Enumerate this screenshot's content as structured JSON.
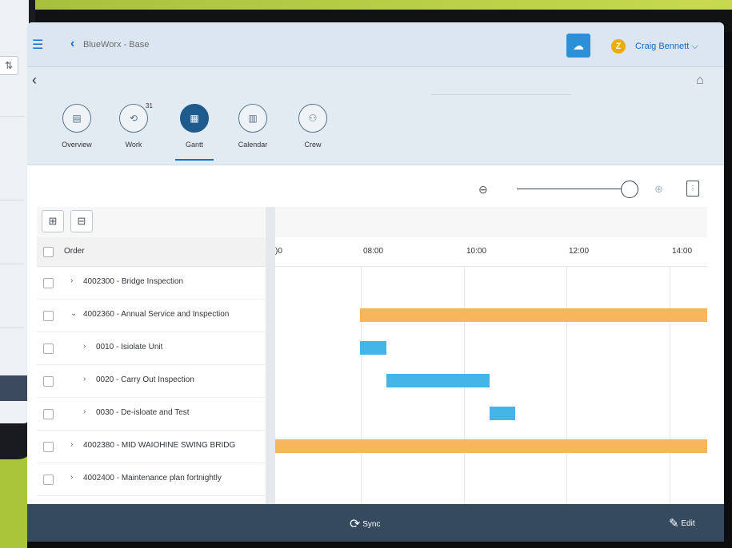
{
  "background": {
    "accent_green": "#a9c63b",
    "frame_dark": "#0d0d0f"
  },
  "left_panel": {
    "sort_icon_glyph": "⇅"
  },
  "shell": {
    "menu_icon": "☰",
    "back_icon": "‹",
    "app_title": "BlueWorx - Base",
    "notification_icon": "☁",
    "logo_letter": "Z",
    "user_name": "Craig Bennett ⌵"
  },
  "subheader": {
    "nav_back": "‹",
    "home_icon": "⌂"
  },
  "tabs": [
    {
      "label": "Overview",
      "icon": "▤",
      "count": ""
    },
    {
      "label": "Work",
      "icon": "⟲",
      "count": "31"
    },
    {
      "label": "Gantt",
      "icon": "▦",
      "count": "",
      "active": true
    },
    {
      "label": "Calendar",
      "icon": "▥",
      "count": ""
    },
    {
      "label": "Crew",
      "icon": "⚇",
      "count": ""
    }
  ],
  "toolbar": {
    "zoom_out": "⊖",
    "zoom_in": "⊕",
    "settings_icon": "⋮"
  },
  "table": {
    "expand_all_icon": "⊞",
    "collapse_all_icon": "⊟",
    "column_header": "Order",
    "rows": [
      {
        "expander": "›",
        "text": "4002300 - Bridge Inspection",
        "level": 0
      },
      {
        "expander": "⌄",
        "text": "4002360 - Annual Service and Inspection",
        "level": 0
      },
      {
        "expander": "›",
        "text": "0010 - Isiolate Unit",
        "level": 1
      },
      {
        "expander": "›",
        "text": "0020 - Carry Out Inspection",
        "level": 1
      },
      {
        "expander": "›",
        "text": "0030 - De-isloate and Test",
        "level": 1
      },
      {
        "expander": "›",
        "text": "4002380 - MID WAIOHINE SWING BRIDG",
        "level": 0
      },
      {
        "expander": "›",
        "text": "4002400 - Maintenance plan fortnightly",
        "level": 0
      }
    ]
  },
  "gantt": {
    "time_labels": [
      ")0",
      "08:00",
      "10:00",
      "12:00",
      "14:00"
    ],
    "colors": {
      "order": "#f7b55c",
      "operation": "#45b4e6"
    },
    "bars": [
      {
        "row": 1,
        "type": "order",
        "start_hour": 7.98,
        "end_hour": 14.8
      },
      {
        "row": 2,
        "type": "operation",
        "start_hour": 7.98,
        "end_hour": 8.5
      },
      {
        "row": 3,
        "type": "operation",
        "start_hour": 8.5,
        "end_hour": 10.5
      },
      {
        "row": 4,
        "type": "operation",
        "start_hour": 10.5,
        "end_hour": 11.0
      },
      {
        "row": 5,
        "type": "order",
        "start_hour": 6.3,
        "end_hour": 14.8
      }
    ]
  },
  "footer": {
    "sync_icon": "⟳",
    "sync_label": "Sync",
    "edit_icon": "✎",
    "edit_label": "Edit"
  }
}
